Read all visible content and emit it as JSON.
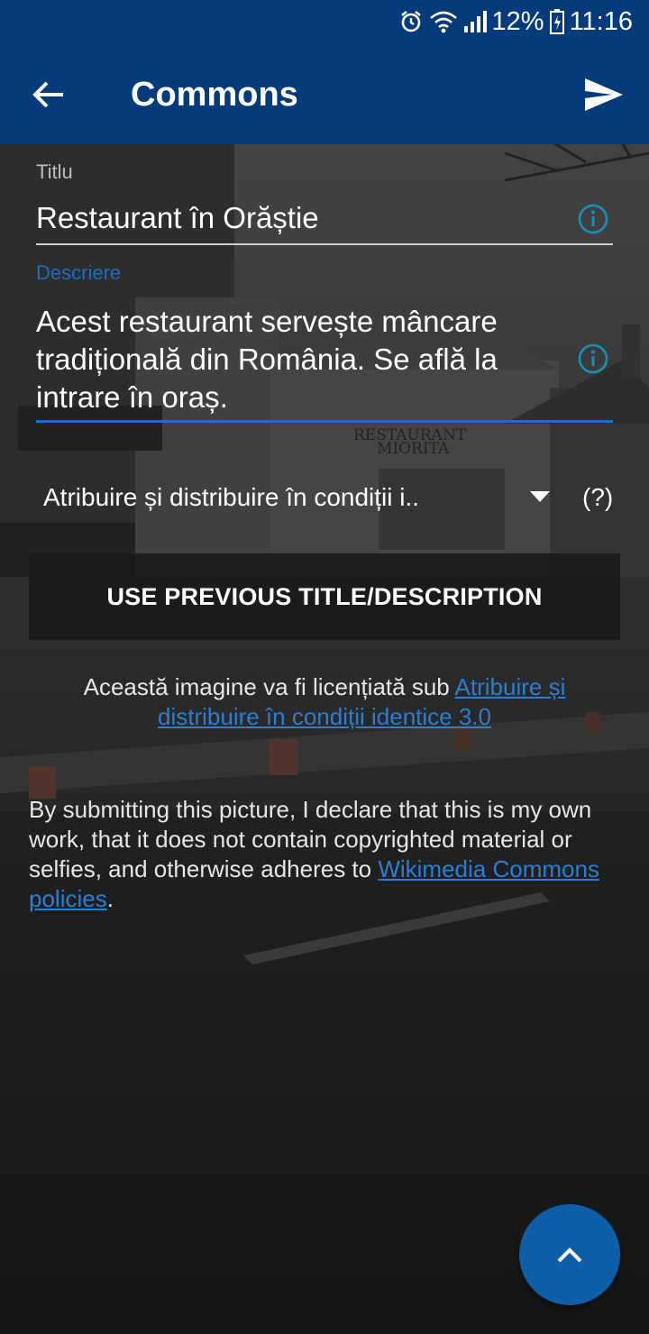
{
  "status_bar": {
    "battery": "12%",
    "time": "11:16",
    "icons": [
      "alarm-icon",
      "wifi-icon",
      "signal-icon",
      "battery-icon"
    ]
  },
  "toolbar": {
    "title": "Commons",
    "back_icon": "arrow-back-icon",
    "send_icon": "send-icon"
  },
  "form": {
    "title_label": "Titlu",
    "title_value": "Restaurant în Orăștie",
    "description_label": "Descriere",
    "description_value": "Acest restaurant servește mâncare tradițională din România. Se află la intrare în oraș.",
    "license_selected": "Atribuire și distribuire în condiții i..",
    "license_help": "(?)",
    "previous_button": "USE PREVIOUS TITLE/DESCRIPTION"
  },
  "license_note": {
    "text": "Această imagine va fi licențiată sub ",
    "link": "Atribuire și distribuire în condiții identice 3.0"
  },
  "declaration": {
    "text": "By submitting this picture, I declare that this is my own work, that it does not contain copyrighted material or selfies, and otherwise adheres to ",
    "link": "Wikimedia Commons policies",
    "suffix": "."
  },
  "background_sign": {
    "line1": "RESTAURANT",
    "line2": "MIORITA"
  },
  "colors": {
    "app_bar": "#053b7a",
    "accent": "#1e6ec0",
    "link": "#2a7fd4",
    "info_icon": "#1a8fb8",
    "fab": "#0f5ea8"
  },
  "fab": {
    "icon": "chevron-up-icon"
  }
}
